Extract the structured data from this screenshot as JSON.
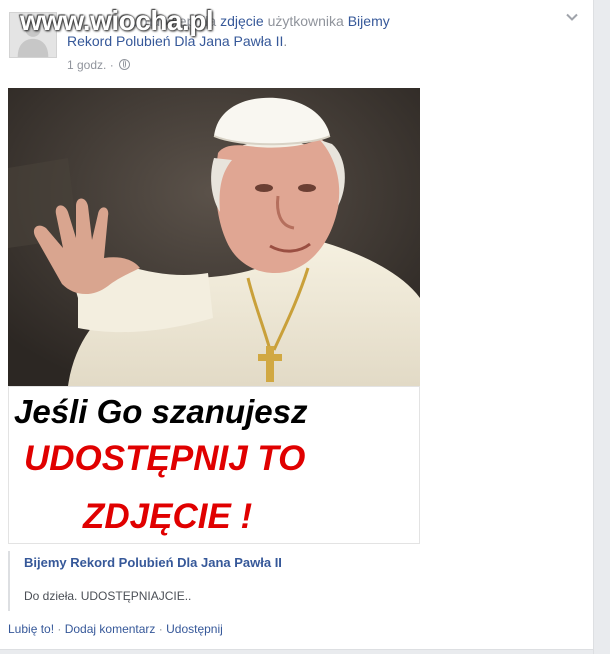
{
  "watermark": {
    "text": "www.wiocha.pl"
  },
  "post": {
    "author_truncated": "...",
    "action_text": "udostępniła",
    "object_link": "zdjęcie",
    "of_user_text": "użytkownika",
    "page_name_part1": "Bijemy",
    "page_name_part2": "Rekord Polubień Dla Jana Pawła II",
    "period": ".",
    "time": "1 godz.",
    "time_separator": "·",
    "privacy_icon": "globe-icon",
    "options_icon": "chevron-down-icon"
  },
  "image_caption": {
    "line1": "Jeśli Go szanujesz",
    "line2": "UDOSTĘPNIJ TO",
    "line3": "ZDJĘCIE !",
    "color_line1": "#000000",
    "color_emphasis": "#e00000"
  },
  "link_preview": {
    "title": "Bijemy Rekord Polubień Dla Jana Pawła II",
    "description": "Do dzieła. UDOSTĘPNIAJCIE.."
  },
  "actions": {
    "like": "Lubię to!",
    "sep": " · ",
    "comment": "Dodaj komentarz",
    "share": "Udostępnij"
  },
  "colors": {
    "link": "#365899",
    "muted": "#90949c",
    "text": "#4b4f56"
  }
}
